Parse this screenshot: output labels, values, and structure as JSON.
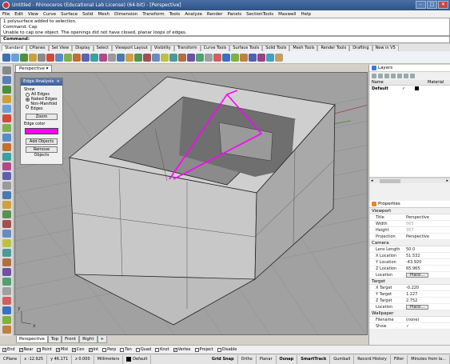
{
  "window": {
    "title": "Untitled - Rhinoceros (Educational Lab License) (64-bit) - [Perspective]",
    "buttons": [
      "–",
      "□",
      "✕"
    ]
  },
  "menu": [
    "File",
    "Edit",
    "View",
    "Curve",
    "Surface",
    "Solid",
    "Mesh",
    "Dimension",
    "Transform",
    "Tools",
    "Analyze",
    "Render",
    "Panels",
    "SectionTools",
    "Maxwell",
    "Help"
  ],
  "command_history": [
    "1 polysurface added to selection.",
    "Command: Cap",
    "Unable to cap one object. The openings did not have closed, planar loops of edges."
  ],
  "command_prompt": "Command:",
  "toolbar_tabs": [
    "Standard",
    "CPlanes",
    "Set View",
    "Display",
    "Select",
    "Viewport Layout",
    "Visibility",
    "Transform",
    "Curve Tools",
    "Surface Tools",
    "Solid Tools",
    "Mesh Tools",
    "Render Tools",
    "Drafting",
    "New in V5"
  ],
  "viewport": {
    "active_title": "Perspective",
    "tabs": [
      "Perspective",
      "Top",
      "Front",
      "Right",
      "+"
    ],
    "axis_x": "x",
    "axis_y": "y",
    "bg_color": "#a1a1a1",
    "naked_edge_color": "#ff00ff"
  },
  "edge_analysis": {
    "title": "Edge Analysis",
    "close": "×",
    "show_label": "Show",
    "options": [
      "All Edges",
      "Naked Edges",
      "Non-Manifold Edges"
    ],
    "selected_option": "Naked Edges",
    "zoom_label": "Zoom",
    "edge_color_label": "Edge color",
    "edge_color": "#ff00ff",
    "add_objects": "Add Objects",
    "remove_objects": "Remove Objects"
  },
  "layers": {
    "panel_title": "Layers",
    "columns": [
      "Name",
      "Material"
    ],
    "rows": [
      {
        "name": "Default",
        "current": "✓",
        "color": "#000000"
      }
    ]
  },
  "properties": {
    "panel_title": "Properties",
    "sections": [
      {
        "title": "Viewport",
        "rows": [
          {
            "key": "Title",
            "value": "Perspective",
            "dim": false
          },
          {
            "key": "Width",
            "value": "565",
            "dim": true
          },
          {
            "key": "Height",
            "value": "357",
            "dim": true
          },
          {
            "key": "Projection",
            "value": "Perspective",
            "dim": false
          }
        ]
      },
      {
        "title": "Camera",
        "rows": [
          {
            "key": "Lens Length",
            "value": "50.0",
            "dim": false
          },
          {
            "key": "X Location",
            "value": "51.532",
            "dim": false
          },
          {
            "key": "Y Location",
            "value": "-43.920",
            "dim": false
          },
          {
            "key": "Z Location",
            "value": "65.965",
            "dim": false
          },
          {
            "key": "Location",
            "value": "Place...",
            "dim": false
          }
        ]
      },
      {
        "title": "Target",
        "rows": [
          {
            "key": "X Target",
            "value": "-0.220",
            "dim": false
          },
          {
            "key": "Y Target",
            "value": "1.227",
            "dim": false
          },
          {
            "key": "Z Target",
            "value": "2.752",
            "dim": false
          },
          {
            "key": "Location",
            "value": "Place...",
            "dim": false
          }
        ]
      },
      {
        "title": "Wallpaper",
        "rows": [
          {
            "key": "Filename",
            "value": "(none)",
            "dim": false
          },
          {
            "key": "Show",
            "value": "✓",
            "dim": false
          }
        ]
      }
    ]
  },
  "osnaps": [
    {
      "label": "End",
      "on": true
    },
    {
      "label": "Near",
      "on": true
    },
    {
      "label": "Point",
      "on": true
    },
    {
      "label": "Mid",
      "on": true
    },
    {
      "label": "Cen",
      "on": true
    },
    {
      "label": "Int",
      "on": true
    },
    {
      "label": "Perp",
      "on": false
    },
    {
      "label": "Tan",
      "on": false
    },
    {
      "label": "Quad",
      "on": false
    },
    {
      "label": "Knot",
      "on": false
    },
    {
      "label": "Vertex",
      "on": true
    },
    {
      "label": "Project",
      "on": false
    },
    {
      "label": "Disable",
      "on": false
    }
  ],
  "status": {
    "cplane": "CPlane",
    "x": "x -12.925",
    "y": "y 46.171",
    "z": "z 0.000",
    "units": "Millimeters",
    "layer": "Default",
    "toggles": [
      "Grid Snap",
      "Ortho",
      "Planar",
      "Osnap",
      "SmartTrack",
      "Gumball",
      "Record History",
      "Filter",
      "Minutes from la..."
    ],
    "bold_toggles": [
      "Grid Snap",
      "Osnap",
      "SmartTrack"
    ]
  }
}
